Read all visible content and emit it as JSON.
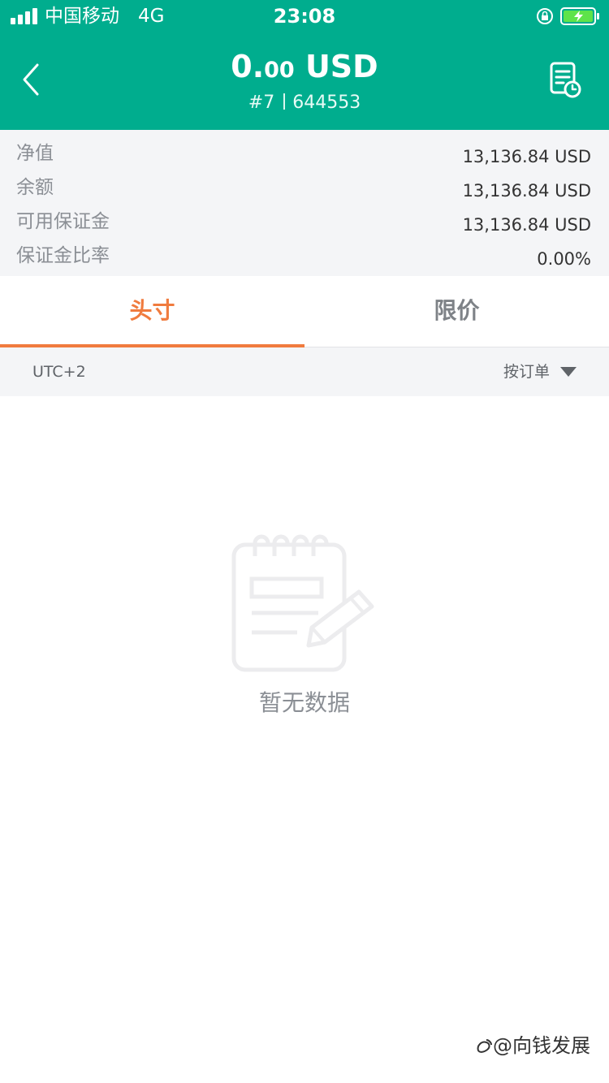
{
  "status_bar": {
    "carrier": "中国移动",
    "network": "4G",
    "time": "23:08"
  },
  "nav": {
    "amount_main": "0.",
    "amount_decimals": "00",
    "currency": "USD",
    "account_number": "#7",
    "account_id": "644553"
  },
  "summary": {
    "items": [
      {
        "label": "净值",
        "value": "13,136.84 USD"
      },
      {
        "label": "余额",
        "value": "13,136.84 USD"
      },
      {
        "label": "可用保证金",
        "value": "13,136.84 USD"
      },
      {
        "label": "保证金比率",
        "value": "0.00%"
      }
    ]
  },
  "tabs": [
    {
      "label": "头寸",
      "active": true
    },
    {
      "label": "限价",
      "active": false
    }
  ],
  "filter": {
    "timezone": "UTC+2",
    "sort_label": "按订单"
  },
  "empty_state": {
    "text": "暂无数据"
  },
  "watermark": {
    "text": "@向钱发展"
  },
  "icons": {
    "back": "chevron-left-icon",
    "history": "document-clock-icon",
    "empty": "notepad-pencil-icon"
  },
  "colors": {
    "header_bg": "#00ad8e",
    "accent": "#f07b3e",
    "battery": "#5ee34a"
  }
}
